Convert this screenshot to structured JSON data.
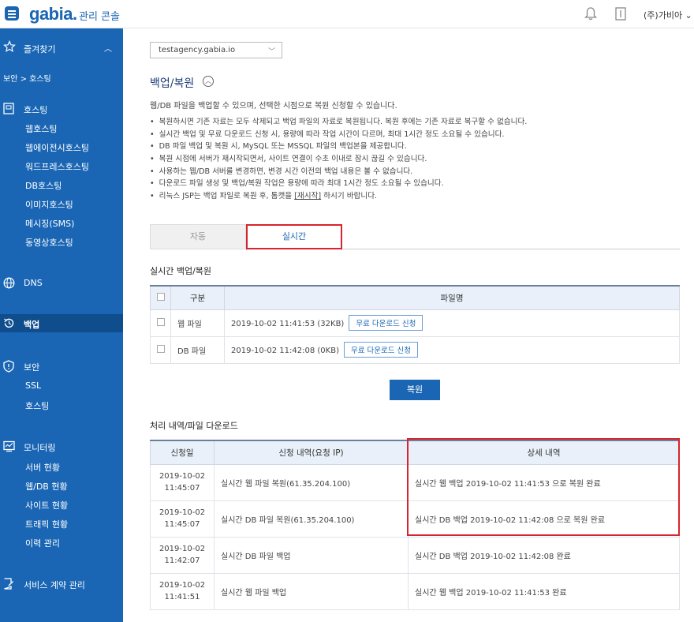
{
  "header": {
    "logo": "gabia.",
    "logo_sub": "관리 콘솔",
    "user": "(주)가비아 ⌄"
  },
  "sidebar": {
    "favorites": "즐겨찾기",
    "breadcrumb": "보안 > 호스팅",
    "hosting": {
      "title": "호스팅",
      "items": [
        "웹호스팅",
        "웹에이전시호스팅",
        "워드프레스호스팅",
        "DB호스팅",
        "이미지호스팅",
        "메시징(SMS)",
        "동영상호스팅"
      ]
    },
    "dns": "DNS",
    "backup": "백업",
    "security": {
      "title": "보안",
      "items": [
        "SSL",
        "호스팅"
      ]
    },
    "monitoring": {
      "title": "모니터링",
      "items": [
        "서버 현황",
        "웹/DB 현황",
        "사이트 현황",
        "트래픽 현황",
        "이력 관리"
      ]
    },
    "contract": "서비스 계약 관리"
  },
  "main": {
    "domain_select": "testagency.gabia.io",
    "title": "백업/복원",
    "description": "웹/DB 파일을 백업할 수 있으며, 선택한 시점으로 복원 신청할 수 있습니다.",
    "bullets": [
      "복원하시면 기존 자료는 모두 삭제되고 백업 파일의 자료로 복원됩니다. 복원 후에는 기존 자료로 복구할 수 없습니다.",
      "실시간 백업 및 무료 다운로드 신청 시, 용량에 따라 작업 시간이 다르며, 최대 1시간 정도 소요될 수 있습니다.",
      "DB 파일 백업 및 복원 시, MySQL 또는 MSSQL 파일의 백업본을 제공합니다.",
      "복원 시점에 서버가 재시작되면서, 사이트 연결이 수초 이내로 잠시 끊길 수 있습니다.",
      "사용하는 웹/DB 서버를 변경하면, 변경 시간 이전의 백업 내용은 볼 수 없습니다.",
      "다운로드 파일 생성 및 백업/복원 작업은 용량에 따라 최대 1시간 정도 소요될 수 있습니다."
    ],
    "last_bullet_pre": "리눅스 JSP는 백업 파일로 복원 후, 톰캣을 ",
    "last_bullet_link": "[재시작]",
    "last_bullet_post": " 하시기 바랍니다.",
    "tabs": [
      "자동",
      "실시간"
    ],
    "realtime_title": "실시간 백업/복원",
    "realtime_table": {
      "headers": [
        "구분",
        "파일명"
      ],
      "rows": [
        {
          "type": "웹 파일",
          "file": "2019-10-02 11:41:53 (32KB)",
          "button": "무료 다운로드 신청"
        },
        {
          "type": "DB 파일",
          "file": "2019-10-02 11:42:08 (0KB)",
          "button": "무료 다운로드 신청"
        }
      ]
    },
    "restore_button": "복원",
    "history_title": "처리 내역/파일 다운로드",
    "history_table": {
      "headers": [
        "신청일",
        "신청 내역(요청 IP)",
        "상세 내역"
      ],
      "rows": [
        {
          "date": "2019-10-02",
          "time": "11:45:07",
          "request": "실시간 웹 파일 복원(61.35.204.100)",
          "detail": "실시간 웹 백업 2019-10-02 11:41:53 으로 복원 완료"
        },
        {
          "date": "2019-10-02",
          "time": "11:45:07",
          "request": "실시간 DB 파일 복원(61.35.204.100)",
          "detail": "실시간 DB 백업 2019-10-02 11:42:08 으로 복원 완료"
        },
        {
          "date": "2019-10-02",
          "time": "11:42:07",
          "request": "실시간 DB 파일 백업",
          "detail": "실시간 DB 백업 2019-10-02 11:42:08 완료"
        },
        {
          "date": "2019-10-02",
          "time": "11:41:51",
          "request": "실시간 웹 파일 백업",
          "detail": "실시간 웹 백업 2019-10-02 11:41:53 완료"
        }
      ]
    }
  }
}
